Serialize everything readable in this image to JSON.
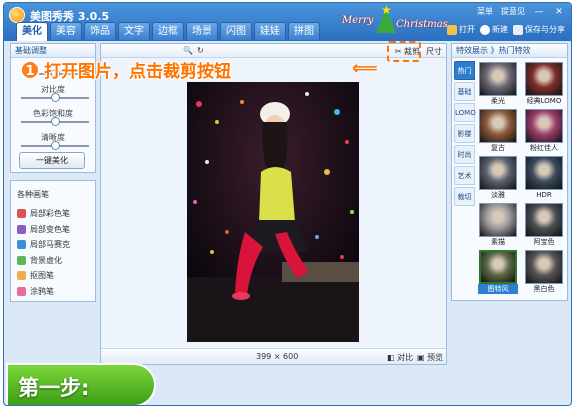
{
  "app": {
    "title": "美图秀秀 3.0.5"
  },
  "tabs": [
    {
      "label": "美化",
      "active": true
    },
    {
      "label": "美容"
    },
    {
      "label": "饰品"
    },
    {
      "label": "文字"
    },
    {
      "label": "边框"
    },
    {
      "label": "场景"
    },
    {
      "label": "闪图"
    },
    {
      "label": "娃娃"
    },
    {
      "label": "拼图"
    }
  ],
  "banner": {
    "merry": "Merry",
    "christmas": "Christmas"
  },
  "top_links": {
    "menu": "菜单",
    "feedback": "提意见",
    "minimize": "—",
    "close": "✕"
  },
  "top_actions": {
    "open": "打开",
    "new": "新建",
    "save": "保存与分享"
  },
  "left_panel": {
    "header": "基础调整",
    "sliders": [
      {
        "label": "",
        "value": 0.5
      },
      {
        "label": "对比度",
        "value": 0.5
      },
      {
        "label": "色彩饱和度",
        "value": 0.5
      },
      {
        "label": "清晰度",
        "value": 0.5
      }
    ],
    "beautify_button": "一键美化"
  },
  "brushes": {
    "header": "各种画笔",
    "items": [
      {
        "label": "局部彩色笔",
        "color": "#d9534f"
      },
      {
        "label": "局部变色笔",
        "color": "#8a5fbf"
      },
      {
        "label": "局部马赛克",
        "color": "#3a8fd8"
      },
      {
        "label": "背景虚化",
        "color": "#5cb85c"
      },
      {
        "label": "抠图笔",
        "color": "#f0ad4e"
      },
      {
        "label": "涂鸦笔",
        "color": "#e26f9c"
      }
    ]
  },
  "canvas": {
    "crop_label": "裁剪",
    "size_label": "尺寸",
    "dimensions": "399 × 600",
    "compare_label": "对比",
    "preview_label": "预览"
  },
  "right_panel": {
    "header": "特效展示 》热门特效",
    "categories": [
      {
        "label": "热门",
        "active": true
      },
      {
        "label": "基础"
      },
      {
        "label": "LOMO"
      },
      {
        "label": "影楼"
      },
      {
        "label": "时尚"
      },
      {
        "label": "艺术"
      },
      {
        "label": "裁切"
      }
    ],
    "effects": [
      {
        "label": "柔光",
        "tone": "#6a6a76"
      },
      {
        "label": "经典LOMO",
        "tone": "#7a2f2a"
      },
      {
        "label": "复古",
        "tone": "#8a5a3a"
      },
      {
        "label": "粉红佳人",
        "tone": "#9b3e6a"
      },
      {
        "label": "淡雅",
        "tone": "#5a6270"
      },
      {
        "label": "HDR",
        "tone": "#3a4b5e"
      },
      {
        "label": "素描",
        "tone": "#9a9a9a"
      },
      {
        "label": "阿宝色",
        "tone": "#4a4f55"
      },
      {
        "label": "图特风",
        "tone": "#5d6a48",
        "selected": true
      },
      {
        "label": "黑白色",
        "tone": "#555555"
      }
    ]
  },
  "annotation": {
    "step_number": "1",
    "instruction": "打开图片，点击裁剪按钮",
    "arrow": "⟸",
    "step_badge": "第一步:"
  }
}
